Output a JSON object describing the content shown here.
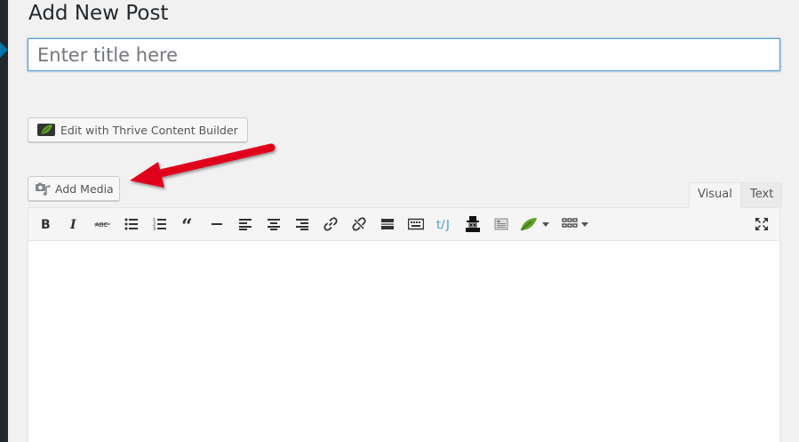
{
  "page": {
    "title": "Add New Post"
  },
  "title_field": {
    "placeholder": "Enter title here",
    "value": ""
  },
  "thrive_button": {
    "label": "Edit with Thrive Content Builder",
    "icon": "leaf-icon"
  },
  "media_button": {
    "label": "Add Media",
    "icon": "media-icon"
  },
  "editor_tabs": [
    {
      "label": "Visual",
      "active": true
    },
    {
      "label": "Text",
      "active": false
    }
  ],
  "toolbar": [
    "bold-icon",
    "italic-icon",
    "strikethrough-icon",
    "bullet-list-icon",
    "numbered-list-icon",
    "blockquote-icon",
    "horizontal-rule-icon",
    "align-left-icon",
    "align-center-icon",
    "align-right-icon",
    "link-icon",
    "unlink-icon",
    "read-more-icon",
    "keyboard-shortcuts-icon",
    "code-icon",
    "spy-icon",
    "page-icon",
    "thrive-leaf-icon",
    "table-grid-icon",
    "fullscreen-icon"
  ],
  "colors": {
    "accent": "#0073aa",
    "arrow": "#e0001b",
    "focus_border": "#5b9dd9",
    "leaf": "#5fa02a"
  }
}
